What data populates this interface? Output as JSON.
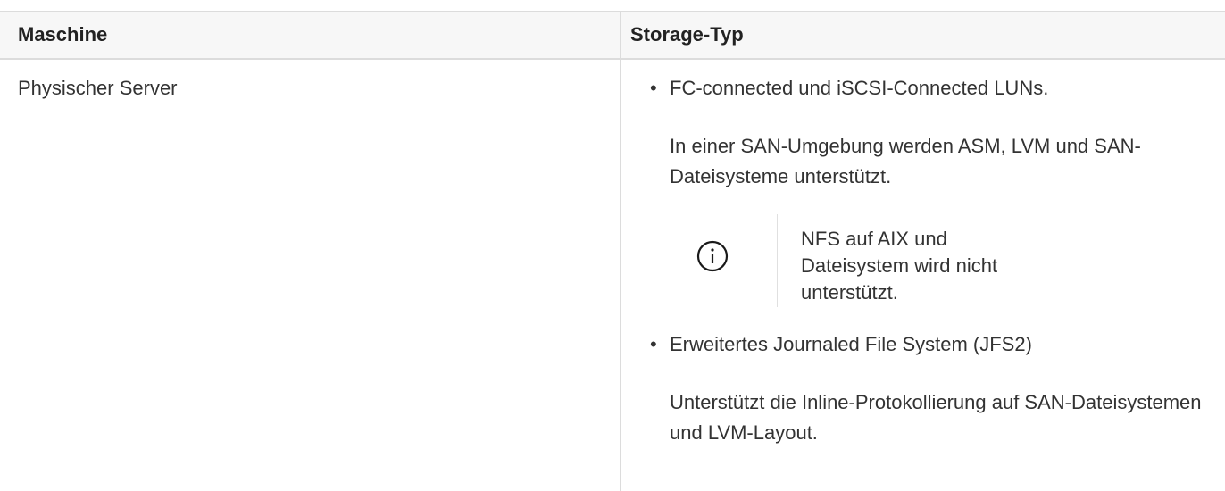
{
  "table": {
    "headers": {
      "machine": "Maschine",
      "storage_type": "Storage-Typ"
    },
    "rows": [
      {
        "machine": "Physischer Server",
        "bullets": [
          {
            "bullet": "•",
            "text": "FC-connected und iSCSI-Connected LUNs.",
            "paragraph": "In einer SAN-Umgebung werden ASM, LVM und SAN-Dateisysteme unterstützt.",
            "note": {
              "icon": "info-icon",
              "text": "NFS auf AIX und Dateisystem wird nicht unterstützt."
            }
          },
          {
            "bullet": "•",
            "text": "Erweitertes Journaled File System (JFS2)",
            "paragraph": "Unterstützt die Inline-Protokollierung auf SAN-Dateisystemen und LVM-Layout."
          }
        ]
      }
    ]
  },
  "colors": {
    "header_bg": "#f7f7f7",
    "border": "#dcdcdc",
    "text": "#333333",
    "icon": "#1a1a1a"
  }
}
